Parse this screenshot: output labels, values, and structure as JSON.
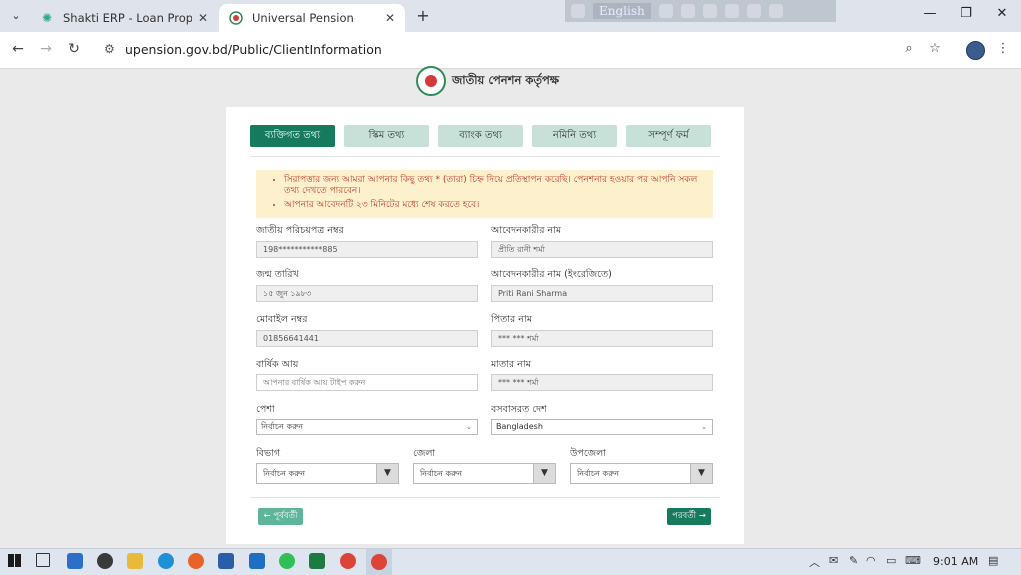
{
  "browser": {
    "tabs": [
      {
        "title": "Shakti ERP - Loan Proposal List",
        "active": false
      },
      {
        "title": "Universal Pension",
        "active": true
      }
    ],
    "url": "upension.gov.bd/Public/ClientInformation",
    "extension_lang": "English"
  },
  "page": {
    "logo_text": "জাতীয় পেনশন কর্তৃপক্ষ",
    "steps": [
      "ব্যক্তিগত তথ্য",
      "স্কিম তথ্য",
      "ব্যাংক তথ্য",
      "নমিনি তথ্য",
      "সম্পূর্ণ ফর্ম"
    ],
    "notice": [
      "সিরাপত্তার জন্য আমরা আপনার কিছু তথ্য * (তারা) চিহ্ন দিয়ে প্রতিস্থাপন করেছি। পেনশনার হওয়ার পর আপনি সকল তথ্য দেখতে পারবেন।",
      "আপনার আবেদনটি ২৩ মিনিটের মধ্যে শেষ করতে হবে।"
    ],
    "fields": {
      "nid_label": "জাতীয় পরিচয়পত্র নম্বর",
      "nid_value": "198***********885",
      "applicant_name_label": "আবেদনকারীর নাম",
      "applicant_name_value": "প্রীতি রানী শর্মা",
      "dob_label": "জন্ম তারিখ",
      "dob_value": "১৫ জুন ১৯৮৩",
      "applicant_name_en_label": "আবেদনকারীর নাম (ইংরেজিতে)",
      "applicant_name_en_value": "Priti Rani Sharma",
      "mobile_label": "মোবাইল নম্বর",
      "mobile_value": "01856641441",
      "father_label": "পিতার নাম",
      "father_value": "*** *** শর্মা",
      "income_label": "বার্ষিক আয়",
      "income_placeholder": "আপনার বার্ষিক আয় টাইপ করুন",
      "mother_label": "মাতার নাম",
      "mother_value": "*** *** শর্মা",
      "occupation_label": "পেশা",
      "occupation_value": "নির্বাচন করুন",
      "country_label": "বসবাসরত দেশ",
      "country_value": "Bangladesh",
      "division_label": "বিভাগ",
      "division_value": "নির্বাচন করুন",
      "district_label": "জেলা",
      "district_value": "নির্বাচন করুন",
      "upazila_label": "উপজেলা",
      "upazila_value": "নির্বাচন করুন"
    },
    "prev_button": "← পূর্ববর্তী",
    "next_button": "পরবর্তী →"
  },
  "taskbar": {
    "time": "9:01 AM"
  },
  "colors": {
    "primary": "#157a5e",
    "step_inactive": "#c7e0d8",
    "notice_bg": "#fdf0cc",
    "notice_text": "#c0392b"
  }
}
